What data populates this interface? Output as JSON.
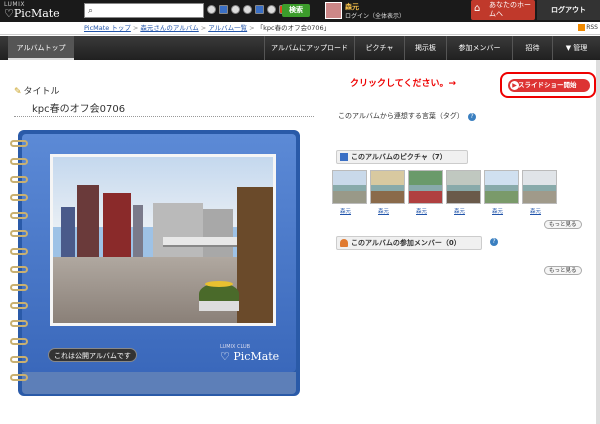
{
  "header": {
    "logo_small": "LUMIX",
    "logo_big": "♡PicMate",
    "search_placeholder": "",
    "search_button": "検索",
    "user_name": "森元",
    "user_status": "ログイン（全体表示）",
    "home_button": "あなたのホームへ",
    "logout_button": "ログアウト"
  },
  "breadcrumb": {
    "items": [
      "PicMate トップ",
      "森元さんのアルバム",
      "アルバム一覧",
      "「kpc春のオフ会0706」"
    ],
    "rss": "RSS"
  },
  "nav": {
    "items": [
      {
        "label": "アルバムトップ",
        "active": true
      },
      {
        "label": "アルバムにアップロード",
        "active": false
      },
      {
        "label": "ピクチャ",
        "active": false
      },
      {
        "label": "掲示板",
        "active": false
      },
      {
        "label": "参加メンバー",
        "active": false
      },
      {
        "label": "招待",
        "active": false
      },
      {
        "label": "▼ 管理",
        "active": false
      }
    ]
  },
  "album": {
    "title_label": "タイトル",
    "title_value": "kpc春のオフ会0706",
    "public_badge": "これは公開アルバムです",
    "logo_small": "LUMIX CLUB",
    "logo_big": "♡ PicMate"
  },
  "right": {
    "callout": "クリックしてください。→",
    "slideshow_button": "スライドショー開始",
    "description_text": "このアルバムから連想する言葉（タグ）",
    "pictures_header": "このアルバムのピクチャ（7）",
    "members_header": "このアルバムの参加メンバー（0）",
    "thumb_caption": "森元",
    "more_label": "もっと見る"
  }
}
